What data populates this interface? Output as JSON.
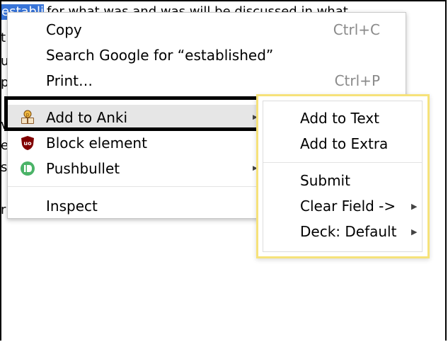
{
  "background_text": {
    "top_line": "for what was and was will be discussed in what",
    "selected_word": "established",
    "left_fragments": [
      "t",
      "u",
      "p",
      "v",
      "e",
      "s",
      "r"
    ]
  },
  "context_menu": {
    "copy": {
      "label": "Copy",
      "shortcut": "Ctrl+C"
    },
    "search": {
      "label": "Search Google for “established”"
    },
    "print": {
      "label": "Print…",
      "shortcut": "Ctrl+P"
    },
    "anki": {
      "label": "Add to Anki",
      "icon": "anki-icon"
    },
    "block": {
      "label": "Block element",
      "icon": "ublock-icon"
    },
    "pushbullet": {
      "label": "Pushbullet",
      "icon": "pushbullet-icon"
    },
    "inspect": {
      "label": "Inspect"
    }
  },
  "submenu": {
    "add_text": "Add to Text",
    "add_extra": "Add to Extra",
    "submit": "Submit",
    "clear_field": "Clear Field ->",
    "deck": "Deck: Default"
  },
  "colors": {
    "highlight_border": "#000000",
    "submenu_border": "#f6e27a",
    "hover_bg": "#e6e6e6",
    "ublock_red": "#800000",
    "pushbullet_green": "#4ab367"
  }
}
